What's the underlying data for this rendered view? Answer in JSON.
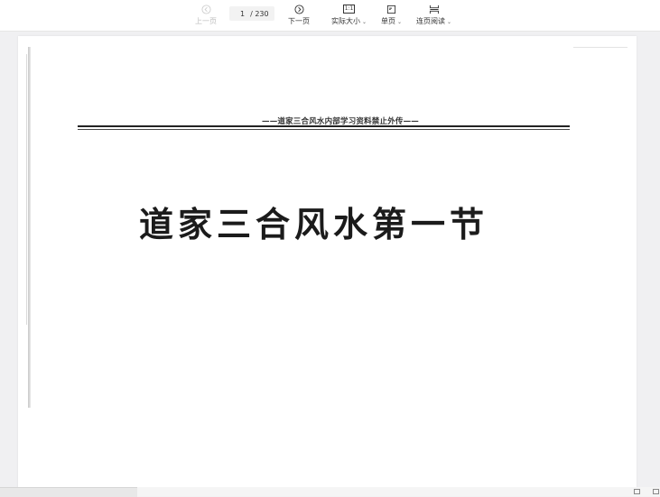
{
  "toolbar": {
    "prev_label": "上一页",
    "page_current": "1",
    "page_total": "/ 230",
    "next_label": "下一页",
    "actual_size_label": "实际大小",
    "actual_size_icon_text": "1:1",
    "single_page_label": "单页",
    "continuous_label": "连页阅读"
  },
  "document": {
    "header_line": "——道家三合风水内部学习资料禁止外传——",
    "title": "道家三合风水第一节"
  },
  "colors": {
    "toolbar_bg": "#ffffff",
    "viewer_bg": "#f0f0f2",
    "page_bg": "#ffffff",
    "text_dark": "#1b1b1b",
    "disabled_text": "#bdbdbd"
  }
}
